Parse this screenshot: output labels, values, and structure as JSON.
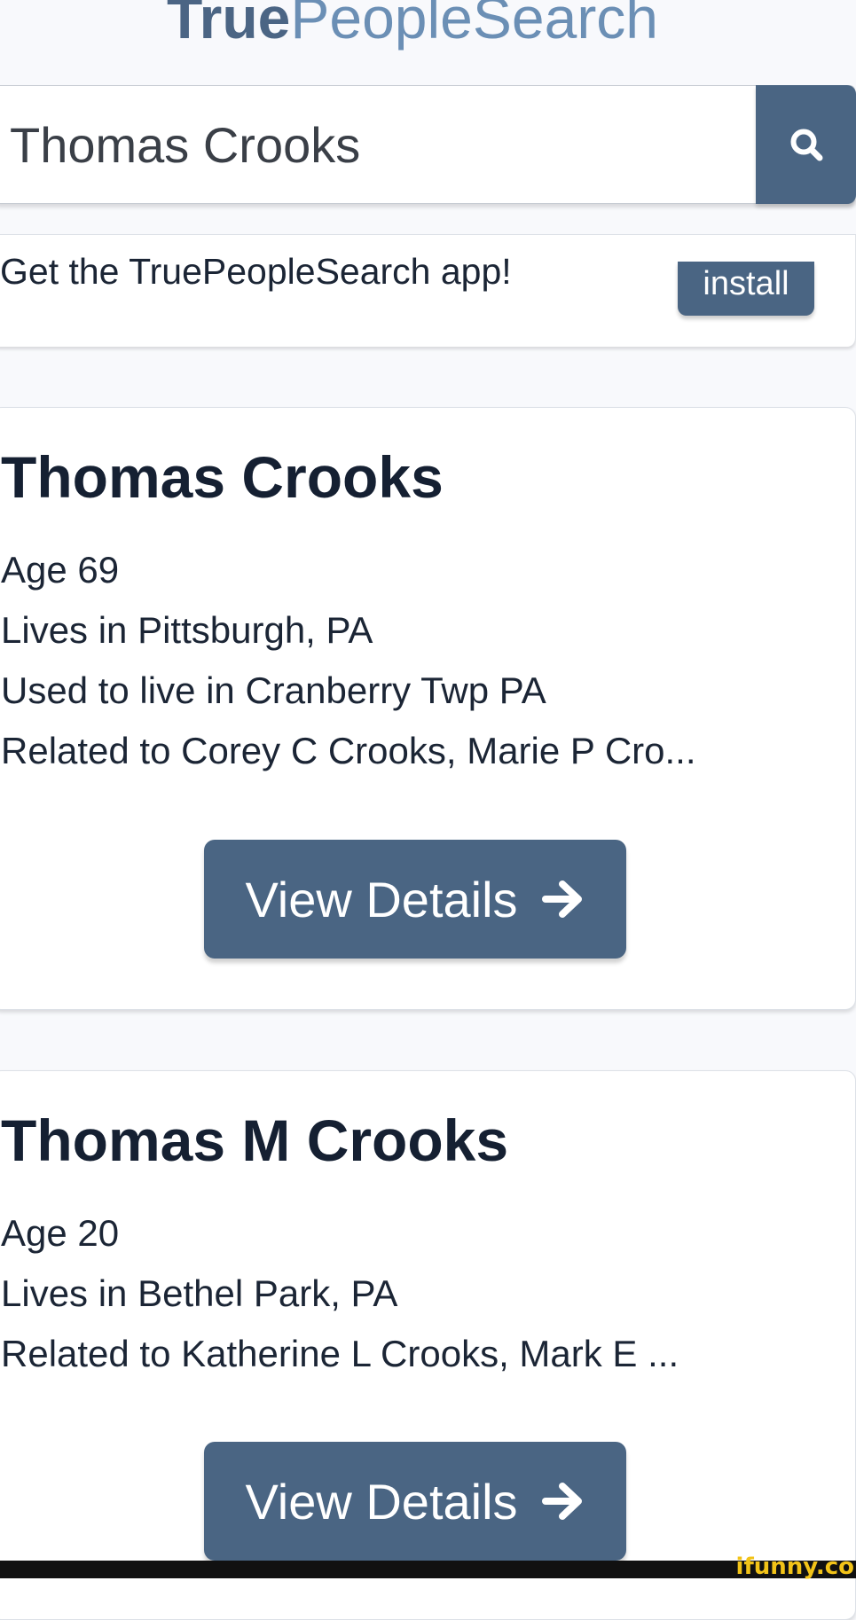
{
  "header": {
    "logo_bold": "True",
    "logo_regular": "PeopleSearch"
  },
  "search": {
    "value": "Thomas Crooks",
    "button_icon": "search-icon"
  },
  "app_banner": {
    "text": "Get the TruePeopleSearch app!",
    "install_label": "install"
  },
  "results": [
    {
      "name": "Thomas Crooks",
      "age": "Age 69",
      "lives_in": "Lives in Pittsburgh, PA",
      "used_to_live": "Used to live in Cranberry Twp PA",
      "related": "Related to Corey C Crooks, Marie P Cro...",
      "button_label": "View Details",
      "button_icon": "arrow-right-icon"
    },
    {
      "name": "Thomas M Crooks",
      "age": "Age 20",
      "lives_in": "Lives in Bethel Park, PA",
      "related": "Related to Katherine L Crooks, Mark E ...",
      "button_label": "View Details",
      "button_icon": "arrow-right-icon"
    }
  ],
  "watermark": "ifunny.co",
  "colors": {
    "accent": "#4a6583",
    "logo_bold": "#4b6584",
    "logo_light": "#6b8fb5",
    "background": "#f8f9fc",
    "watermark": "#f2c318"
  }
}
